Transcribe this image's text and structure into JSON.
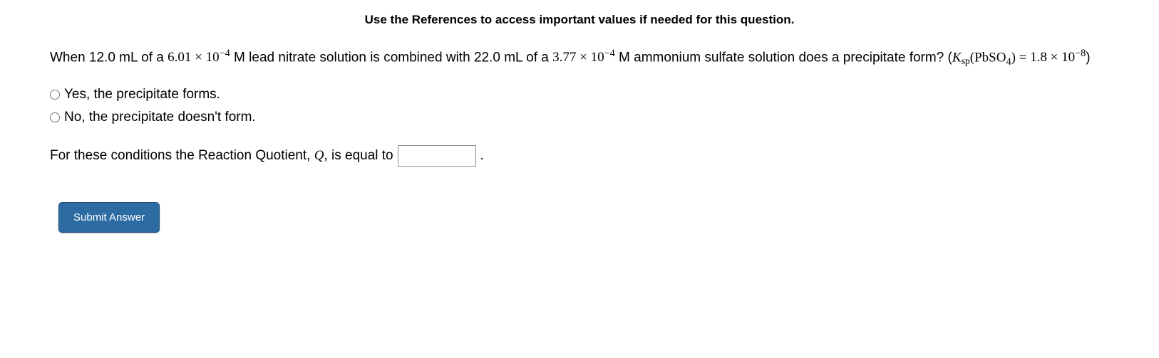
{
  "header": {
    "instruction": "Use the References to access important values if needed for this question."
  },
  "question": {
    "p1_a": "When ",
    "vol1": "12.0",
    "p1_b": " mL of a ",
    "conc1_base": "6.01",
    "conc1_exp": "−4",
    "p1_c": " M lead nitrate solution is combined with ",
    "vol2": "22.0",
    "p1_d": " mL of a ",
    "conc2_base": "3.77",
    "conc2_exp": "−4",
    "p1_e": " M ammonium sulfate solution does a precipitate form? (",
    "ksp_label_K": "K",
    "ksp_label_sp": "sp",
    "ksp_compound_pb": "PbSO",
    "ksp_compound_4": "4",
    "ksp_eq": " = ",
    "ksp_base": "1.8",
    "ksp_exp": "−8",
    "p1_f": ")"
  },
  "options": {
    "yes": "Yes, the precipitate forms.",
    "no": "No, the precipitate doesn't form."
  },
  "quotient": {
    "prefix": "For these conditions the Reaction Quotient, ",
    "q_symbol": "Q",
    "middle": ", is equal to",
    "suffix": "."
  },
  "buttons": {
    "submit": "Submit Answer"
  },
  "math": {
    "times": " × 10"
  }
}
